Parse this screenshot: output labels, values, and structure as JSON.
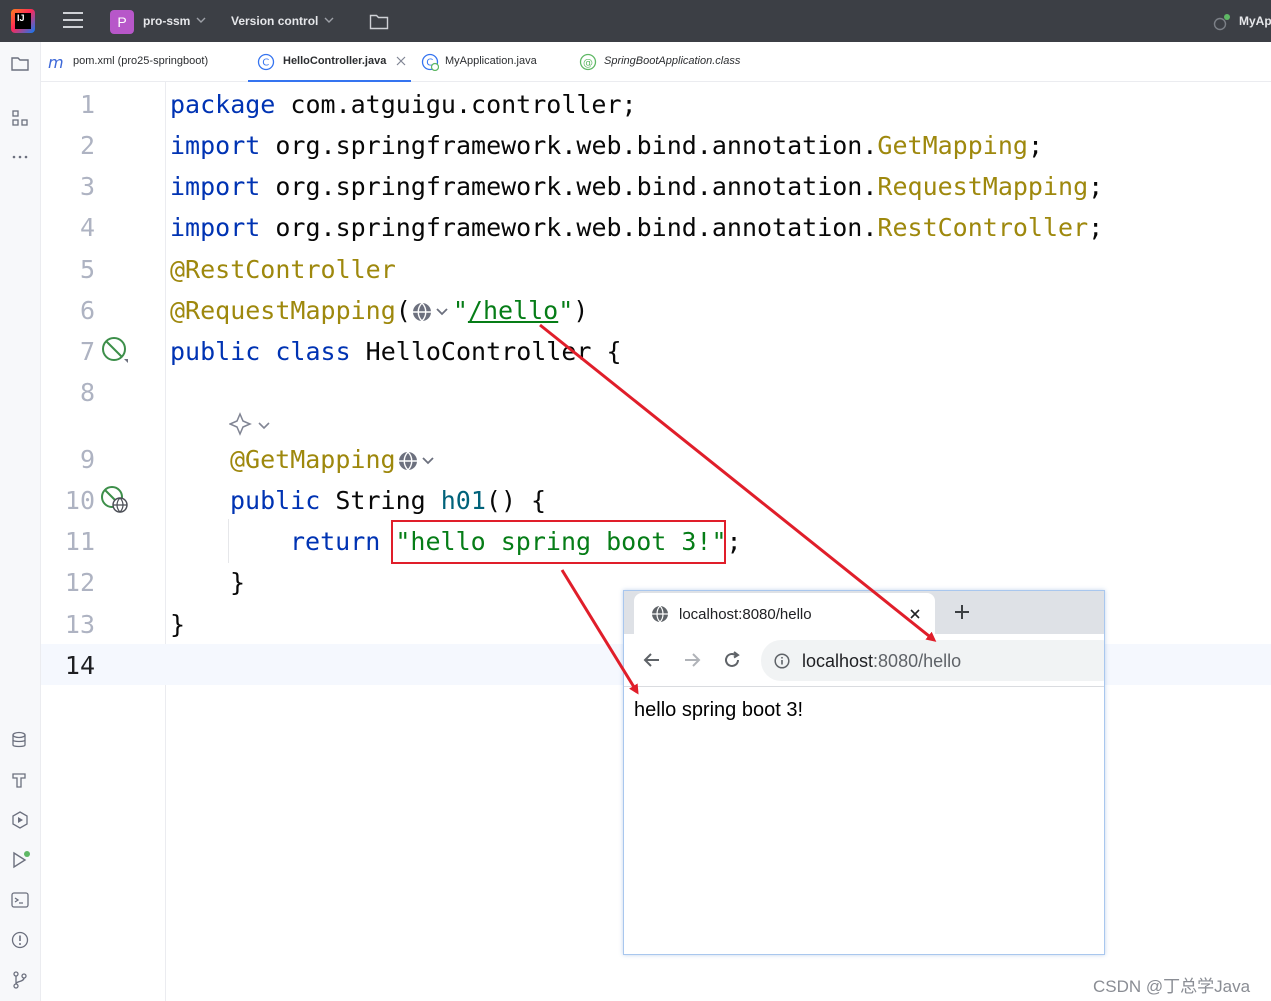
{
  "titlebar": {
    "project_badge": "P",
    "project_name": "pro-ssm",
    "vcs_label": "Version control",
    "right_label": "MyAp"
  },
  "tabs": [
    {
      "label": "pom.xml (pro25-springboot)",
      "icon": "maven-m-icon"
    },
    {
      "label": "HelloController.java",
      "icon": "class-c-icon",
      "active": true
    },
    {
      "label": "MyApplication.java",
      "icon": "spring-boot-class-icon"
    },
    {
      "label": "SpringBootApplication.class",
      "icon": "annotation-at-icon"
    }
  ],
  "editor": {
    "line_numbers": [
      "1",
      "2",
      "3",
      "4",
      "5",
      "6",
      "7",
      "8",
      "9",
      "10",
      "11",
      "12",
      "13",
      "14"
    ],
    "current_line": "14",
    "code": {
      "l1_kw": "package",
      "l1_rest": " com.atguigu.controller;",
      "import_kw": "import",
      "l2_pkg": " org.springframework.web.bind.annotation.",
      "l2_cls": "GetMapping",
      "l3_cls": "RequestMapping",
      "l4_cls": "RestController",
      "semicolon": ";",
      "l5_ann": "@RestController",
      "l6_ann": "@RequestMapping",
      "l6_open": "(",
      "l6_q1": "\"",
      "l6_path": "/hello",
      "l6_q2": "\"",
      "l6_close": ")",
      "l7_kw": "public class",
      "l7_rest": " HelloController {",
      "l9_ann": "@GetMapping",
      "l10_kw": "public",
      "l10_type": " String ",
      "l10_fn": "h01",
      "l10_rest": "() {",
      "l11_kw": "return",
      "l11_str": "\"hello spring boot 3!\"",
      "l11_end": ";",
      "l12": "}",
      "l13": "}"
    }
  },
  "browser": {
    "tab_title": "localhost:8080/hello",
    "url_host": "localhost",
    "url_rest": ":8080/hello",
    "content": "hello spring boot 3!"
  },
  "watermark": "CSDN @丁总学Java",
  "colors": {
    "keyword": "#0033b3",
    "annotation": "#9e880d",
    "string": "#067d17",
    "function": "#00627a",
    "highlight_red": "#e01e2a",
    "titlebar_bg": "#3c3f45"
  }
}
